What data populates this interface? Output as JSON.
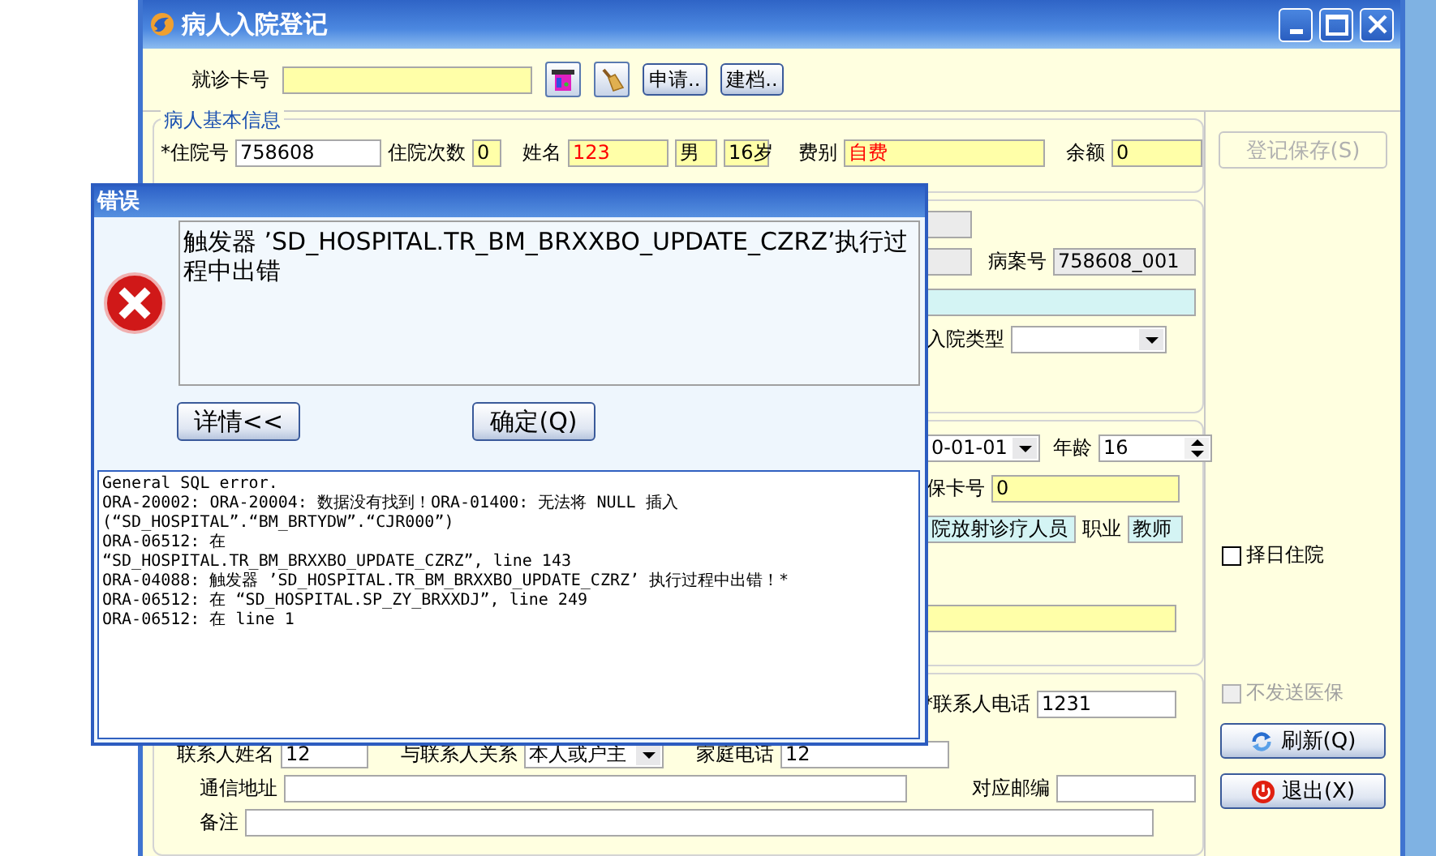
{
  "window": {
    "title": "病人入院登记"
  },
  "card": {
    "label": "就诊卡号",
    "buttons": [
      "申请..",
      "建档.."
    ]
  },
  "basic": {
    "legend": "病人基本信息",
    "fields": [
      {
        "label": "*住院号",
        "value": "758608",
        "kind": "input"
      },
      {
        "label": "住院次数",
        "value": "0",
        "kind": "input"
      },
      {
        "label": "姓名",
        "value": "123",
        "kind": "input"
      },
      {
        "value": "男",
        "kind": "input"
      },
      {
        "value": "16岁",
        "kind": "input"
      },
      {
        "label": "费别",
        "value": "自费",
        "kind": "input"
      },
      {
        "label": "余额",
        "value": "0",
        "kind": "input"
      }
    ]
  },
  "admission": {
    "fields": [
      {
        "kind": "input"
      },
      {
        "kind": "input"
      },
      {
        "label": "病案号",
        "value": "758608_001",
        "kind": "input"
      },
      {
        "kind": "input"
      },
      {
        "label": "入院类型",
        "kind": "select"
      }
    ]
  },
  "details": {
    "fields": [
      {
        "value": "0-01-01",
        "kind": "select"
      },
      {
        "label": "年龄",
        "value": "16",
        "kind": "spinner"
      },
      {
        "label": "保卡号",
        "value": "0",
        "kind": "input"
      },
      {
        "value": "院放射诊疗人员",
        "kind": "input"
      },
      {
        "label": "职业",
        "value": "教师",
        "kind": "input"
      },
      {
        "kind": "input"
      }
    ]
  },
  "contact": {
    "fields": [
      {
        "label": "*联系人电话",
        "value": "1231",
        "kind": "input"
      },
      {
        "label": "联系人姓名",
        "value": "12",
        "kind": "input"
      },
      {
        "label": "与联系人关系",
        "value": "本人或户主",
        "kind": "select"
      },
      {
        "label": "家庭电话",
        "value": "12",
        "kind": "input"
      },
      {
        "label": "通信地址",
        "kind": "input"
      },
      {
        "label": "对应邮编",
        "kind": "input"
      },
      {
        "label": "备注",
        "kind": "input"
      }
    ]
  },
  "side": {
    "save_button": {
      "label": "登记保存(S)",
      "disabled": true
    },
    "checkboxes": [
      {
        "label": "择日住院",
        "checked": false,
        "disabled": false
      },
      {
        "label": "不发送医保",
        "checked": false,
        "disabled": true
      }
    ],
    "buttons": [
      {
        "label": "刷新(Q)",
        "kind": "refresh"
      },
      {
        "label": "退出(X)",
        "kind": "exit"
      }
    ]
  },
  "dialog": {
    "title": "错误",
    "message": "触发器 ’SD_HOSPITAL.TR_BM_BRXXBO_UPDATE_CZRZ’执行过程中出错",
    "details_button": "详情<<",
    "ok_button": "确定(Q)",
    "details": [
      "General SQL error.",
      "ORA-20002: ORA-20004: 数据没有找到！ORA-01400: 无法将 NULL 插入",
      "(“SD_HOSPITAL”.“BM_BRTYDW”.“CJR000”)",
      "ORA-06512: 在",
      "“SD_HOSPITAL.TR_BM_BRXXBO_UPDATE_CZRZ”, line 143",
      "ORA-04088: 触发器 ’SD_HOSPITAL.TR_BM_BRXXBO_UPDATE_CZRZ’ 执行过程中出错！*",
      "ORA-06512: 在 “SD_HOSPITAL.SP_ZY_BRXXDJ”, line 249",
      "ORA-06512: 在 line 1"
    ]
  }
}
